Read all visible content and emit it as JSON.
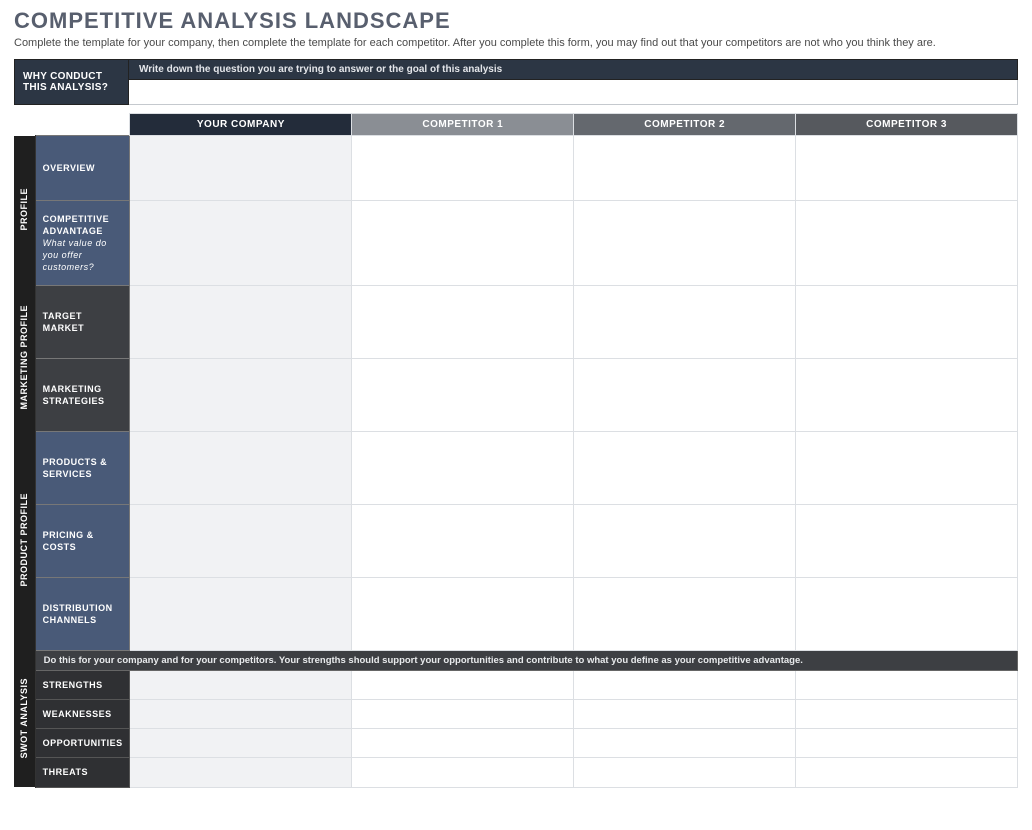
{
  "title": "COMPETITIVE ANALYSIS LANDSCAPE",
  "subtitle": "Complete the template for your company, then complete the template for each competitor. After you complete this form, you may find out that your competitors are not who you think they are.",
  "why": {
    "label": "WHY CONDUCT THIS ANALYSIS?",
    "prompt": "Write down the question you are trying to answer or the goal of this analysis"
  },
  "columns": {
    "company": "YOUR COMPANY",
    "comp1": "COMPETITOR 1",
    "comp2": "COMPETITOR 2",
    "comp3": "COMPETITOR 3"
  },
  "sections": {
    "profile": {
      "label": "PROFILE",
      "rows": {
        "overview": "OVERVIEW",
        "advantage": "COMPETITIVE ADVANTAGE",
        "advantage_hint": "What value do you offer customers?"
      }
    },
    "marketing": {
      "label": "MARKETING PROFILE",
      "rows": {
        "target": "TARGET MARKET",
        "strategies": "MARKETING STRATEGIES"
      }
    },
    "product": {
      "label": "PRODUCT PROFILE",
      "rows": {
        "products": "PRODUCTS & SERVICES",
        "pricing": "PRICING & COSTS",
        "distribution": "DISTRIBUTION CHANNELS"
      }
    },
    "swot": {
      "label": "SWOT ANALYSIS",
      "note": "Do this for your company and for your competitors. Your strengths should support your opportunities and contribute to what you define as your competitive advantage.",
      "rows": {
        "strengths": "STRENGTHS",
        "weaknesses": "WEAKNESSES",
        "opportunities": "OPPORTUNITIES",
        "threats": "THREATS"
      }
    }
  }
}
